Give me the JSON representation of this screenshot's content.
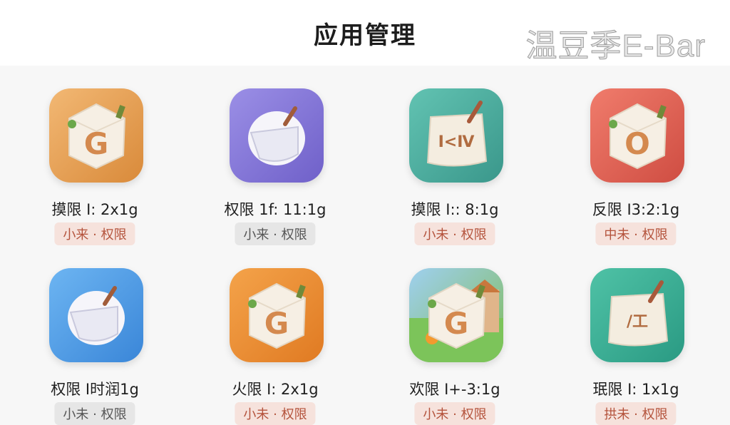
{
  "header": {
    "title": "应用管理",
    "watermark": "温豆季E-Bar"
  },
  "apps": [
    {
      "perm": "摸限 I: 2x1g",
      "tag": "小来 · 权限",
      "icon": "g-cube-icon",
      "bg": [
        "#f2b874",
        "#d98a3a"
      ],
      "tag_bg": "#f6e2dc",
      "tag_fg": "#b4533c",
      "glyph": "G"
    },
    {
      "perm": "权限 1f: 11:1g",
      "tag": "小来 · 权限",
      "icon": "cheese-wheel-icon",
      "bg": [
        "#9b8fe6",
        "#6f60c9"
      ],
      "tag_bg": "#e6e6e6",
      "tag_fg": "#555555",
      "glyph": ""
    },
    {
      "perm": "摸限 I:: 8:1g",
      "tag": "小未 · 权限",
      "icon": "paper-bag-icon",
      "bg": [
        "#62c3b2",
        "#3a978b"
      ],
      "tag_bg": "#f6e2dc",
      "tag_fg": "#b4533c",
      "glyph": "I<Ⅳ"
    },
    {
      "perm": "反限 I3:2:1g",
      "tag": "中未 · 权限",
      "icon": "o-cube-icon",
      "bg": [
        "#f07c6c",
        "#cf4d42"
      ],
      "tag_bg": "#f6e2dc",
      "tag_fg": "#b4533c",
      "glyph": "O"
    },
    {
      "perm": "权限 I时润1g",
      "tag": "小未 · 权限",
      "icon": "cheese-wheel-icon",
      "bg": [
        "#6db5f2",
        "#3a86d8"
      ],
      "tag_bg": "#e6e6e6",
      "tag_fg": "#555555",
      "glyph": ""
    },
    {
      "perm": "火限 I: 2x1g",
      "tag": "小未 · 权限",
      "icon": "g-cube-icon",
      "bg": [
        "#f4a34a",
        "#e07a22"
      ],
      "tag_bg": "#f6e2dc",
      "tag_fg": "#b4533c",
      "glyph": "G"
    },
    {
      "perm": "欢限 I+-3:1g",
      "tag": "小未 · 权限",
      "icon": "landscape-cube-icon",
      "bg": [
        "#9fd0f0",
        "#7fbb58"
      ],
      "tag_bg": "#f6e2dc",
      "tag_fg": "#b4533c",
      "glyph": "G"
    },
    {
      "perm": "珉限 I: 1x1g",
      "tag": "拱未 · 权限",
      "icon": "paper-bag-icon",
      "bg": [
        "#4fc2a6",
        "#2a9a83"
      ],
      "tag_bg": "#f6e2dc",
      "tag_fg": "#b4533c",
      "glyph": "/工"
    }
  ]
}
